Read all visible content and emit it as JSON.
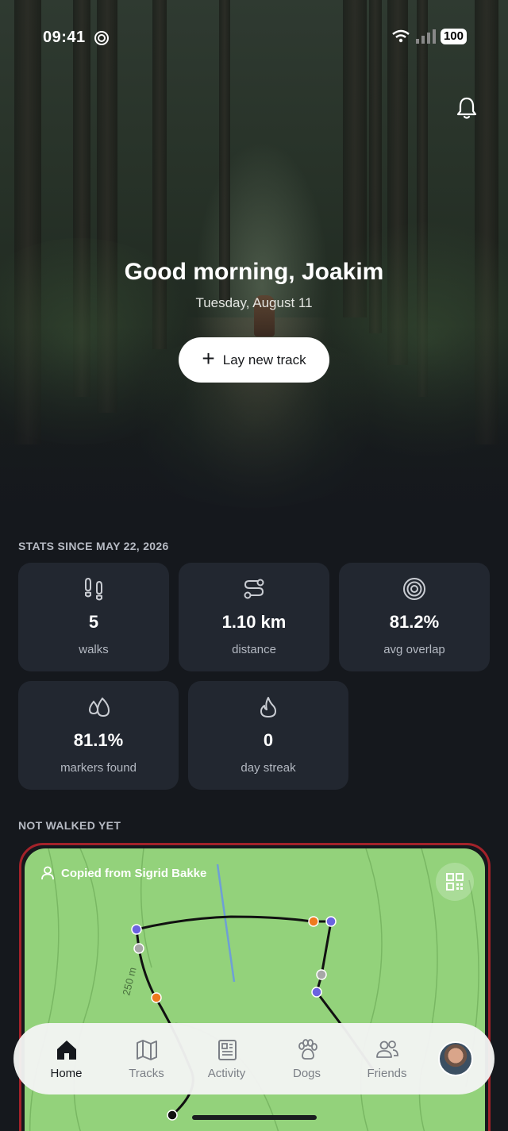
{
  "status_bar": {
    "time": "09:41",
    "battery": "100"
  },
  "hero": {
    "greeting": "Good morning, Joakim",
    "date": "Tuesday, August 11",
    "cta_label": "Lay new track"
  },
  "stats": {
    "section_title": "STATS SINCE MAY 22, 2026",
    "cards": [
      {
        "icon": "footprints-icon",
        "value": "5",
        "label": "walks"
      },
      {
        "icon": "route-icon",
        "value": "1.10 km",
        "label": "distance"
      },
      {
        "icon": "target-icon",
        "value": "81.2%",
        "label": "avg overlap"
      },
      {
        "icon": "droplets-icon",
        "value": "81.1%",
        "label": "markers found"
      },
      {
        "icon": "flame-icon",
        "value": "0",
        "label": "day streak"
      }
    ]
  },
  "not_walked": {
    "section_title": "NOT WALKED YET",
    "copied_from": "Copied from Sigrid Bakke",
    "distance_label": "250 m",
    "colors": {
      "border": "#a3222a",
      "map": "#93d27b",
      "path": "#111111",
      "start": "#6b63e0",
      "marker": "#ee7a1e",
      "waypoint": "#a7a7a7"
    }
  },
  "nav": {
    "items": [
      {
        "label": "Home",
        "active": true
      },
      {
        "label": "Tracks",
        "active": false
      },
      {
        "label": "Activity",
        "active": false
      },
      {
        "label": "Dogs",
        "active": false
      },
      {
        "label": "Friends",
        "active": false
      }
    ]
  }
}
